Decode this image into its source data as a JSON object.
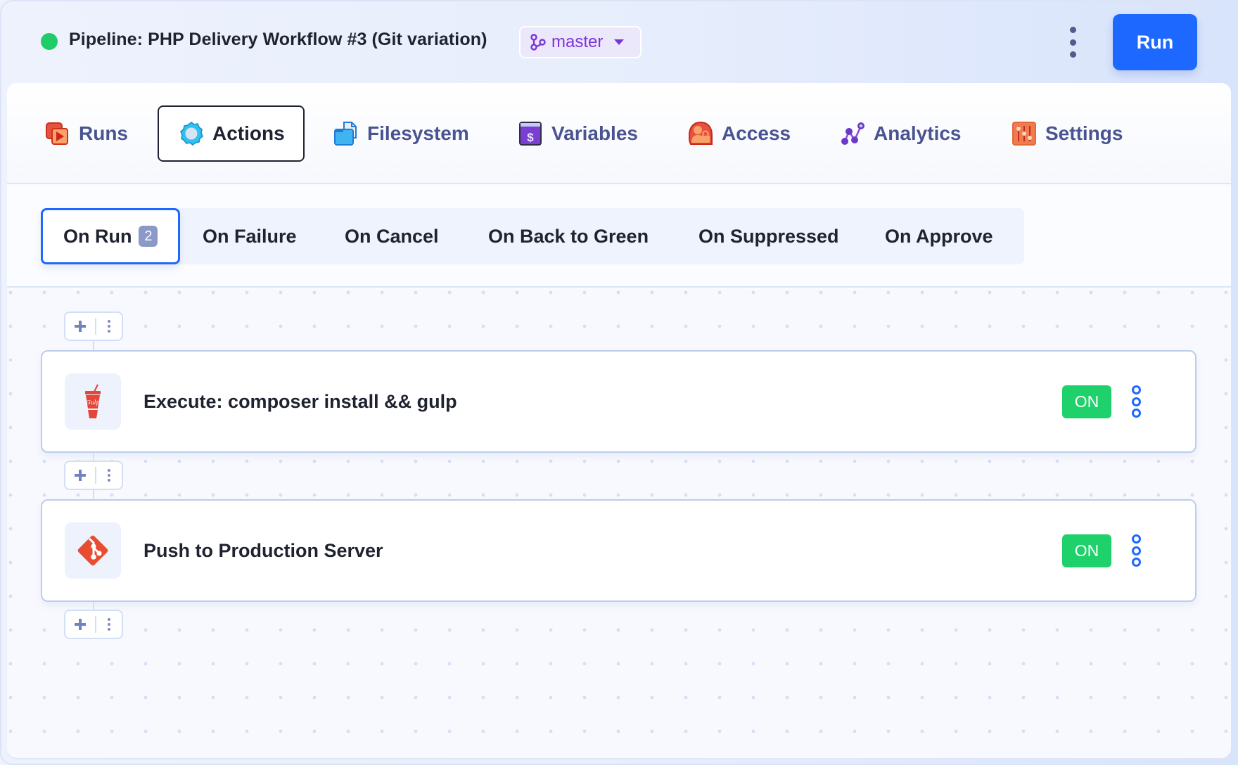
{
  "header": {
    "status": "running",
    "status_color": "#1fcc6a",
    "title": "Pipeline: PHP Delivery Workflow #3 (Git variation)",
    "branch": {
      "icon": "git-branch-icon",
      "label": "master"
    },
    "more_icon": "kebab-vertical-icon",
    "run_label": "Run"
  },
  "tabs": [
    {
      "label": "Runs",
      "icon": "runs-play-icon",
      "active": false
    },
    {
      "label": "Actions",
      "icon": "gear-icon",
      "active": true
    },
    {
      "label": "Filesystem",
      "icon": "file-folder-icon",
      "active": false
    },
    {
      "label": "Variables",
      "icon": "dollar-variable-icon",
      "active": false
    },
    {
      "label": "Access",
      "icon": "user-lock-icon",
      "active": false
    },
    {
      "label": "Analytics",
      "icon": "analytics-nodes-icon",
      "active": false
    },
    {
      "label": "Settings",
      "icon": "sliders-icon",
      "active": false
    }
  ],
  "subtabs": [
    {
      "label": "On Run",
      "count": "2",
      "active": true
    },
    {
      "label": "On Failure",
      "active": false
    },
    {
      "label": "On Cancel",
      "active": false
    },
    {
      "label": "On Back to Green",
      "active": false
    },
    {
      "label": "On Suppressed",
      "active": false
    },
    {
      "label": "On Approve",
      "active": false
    }
  ],
  "actions": [
    {
      "title": "Execute: composer install && gulp",
      "icon": "gulp-icon",
      "status": "ON"
    },
    {
      "title": "Push to Production Server",
      "icon": "git-logo-icon",
      "status": "ON"
    }
  ],
  "colors": {
    "accent": "#1d68ff",
    "on": "#1fd16b",
    "branch": "#7b35d6"
  }
}
